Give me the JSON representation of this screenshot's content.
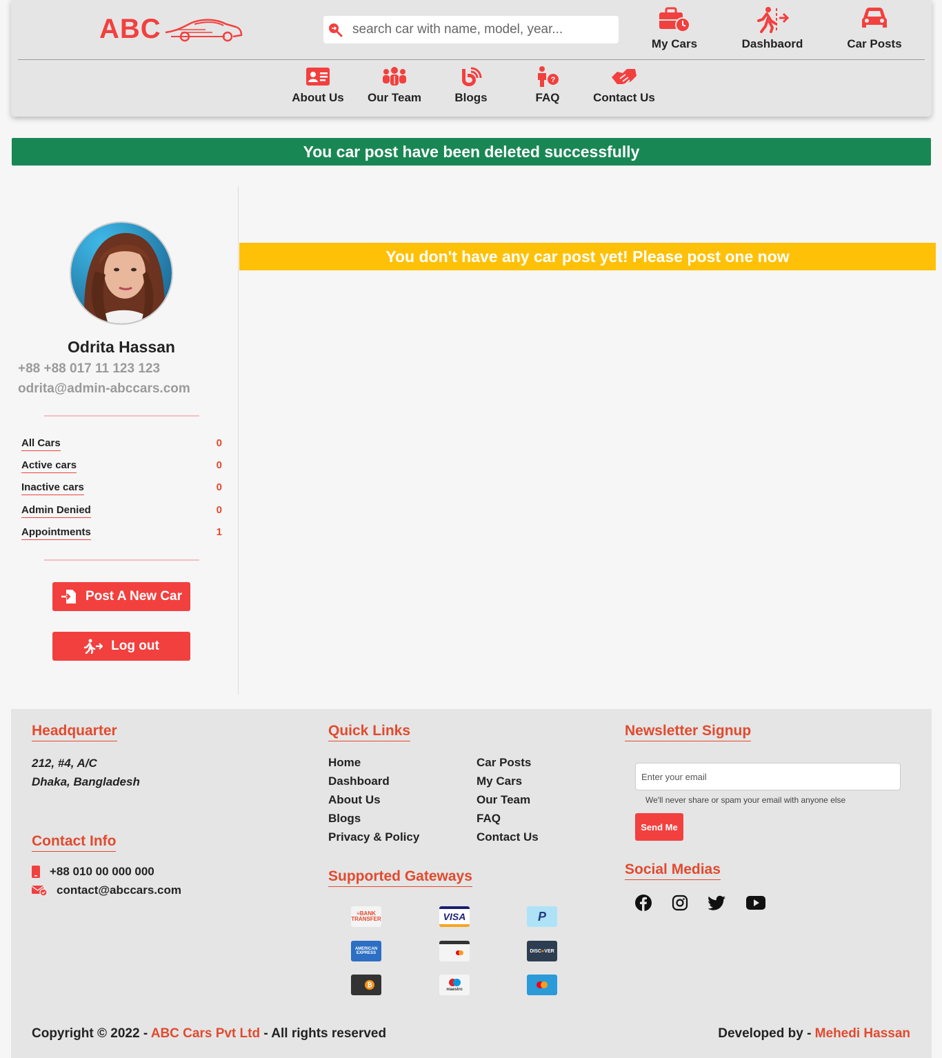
{
  "header": {
    "logo_text": "ABC",
    "search_placeholder": "search car with name, model, year...",
    "top_nav": [
      {
        "label": "My Cars",
        "icon": "briefcase-clock-icon"
      },
      {
        "label": "Dashbaord",
        "icon": "running-exit-icon"
      },
      {
        "label": "Car Posts",
        "icon": "car-icon"
      }
    ],
    "nav": [
      {
        "label": "About Us",
        "icon": "id-card-icon"
      },
      {
        "label": "Our Team",
        "icon": "users-icon"
      },
      {
        "label": "Blogs",
        "icon": "blog-icon"
      },
      {
        "label": "FAQ",
        "icon": "person-question-icon"
      },
      {
        "label": "Contact Us",
        "icon": "handshake-icon"
      }
    ]
  },
  "alerts": {
    "success": "You car post have been deleted successfully",
    "warning": "You don't have any car post yet! Please post one now"
  },
  "profile": {
    "name": "Odrita Hassan",
    "phone": "+88 +88 017 11 123 123",
    "email": "odrita@admin-abccars.com",
    "stats": [
      {
        "label": "All Cars",
        "value": "0"
      },
      {
        "label": "Active cars",
        "value": "0"
      },
      {
        "label": "Inactive cars",
        "value": "0"
      },
      {
        "label": "Admin Denied",
        "value": "0"
      },
      {
        "label": "Appointments",
        "value": "1"
      }
    ],
    "post_button": "Post A New Car",
    "logout_button": "Log out"
  },
  "footer": {
    "headquarter_title": "Headquarter",
    "address_line1": "212, #4, A/C",
    "address_line2": "Dhaka, Bangladesh",
    "contact_title": "Contact Info",
    "phone": "+88 010 00 000 000",
    "email": "contact@abccars.com",
    "quick_links_title": "Quick Links",
    "quick_links_col1": [
      "Home",
      "Dashboard",
      "About Us",
      "Blogs",
      "Privacy & Policy"
    ],
    "quick_links_col2": [
      "Car Posts",
      "My Cars",
      "Our Team",
      "FAQ",
      "Contact Us"
    ],
    "gateways_title": "Supported Gateways",
    "gateways": [
      "BANK TRANSFER",
      "VISA",
      "PayPal",
      "AMERICAN EXPRESS",
      "Card",
      "DISCOVER",
      "Bitcoin",
      "maestro",
      "Mastercard"
    ],
    "newsletter_title": "Newsletter Signup",
    "newsletter_placeholder": "Enter your email",
    "newsletter_help": "We'll never share or spam your email with anyone else",
    "newsletter_button": "Send Me",
    "social_title": "Social Medias",
    "social": [
      "facebook-icon",
      "instagram-icon",
      "twitter-icon",
      "youtube-icon"
    ],
    "copyright_prefix": "Copyright © 2022 - ",
    "copyright_company": "ABC Cars Pvt Ltd",
    "copyright_suffix": " - All rights reserved",
    "developed_prefix": "Developed by - ",
    "developer": "Mehedi Hassan"
  },
  "colors": {
    "accent": "#f2403f",
    "success": "#198754",
    "warning": "#ffc107"
  }
}
